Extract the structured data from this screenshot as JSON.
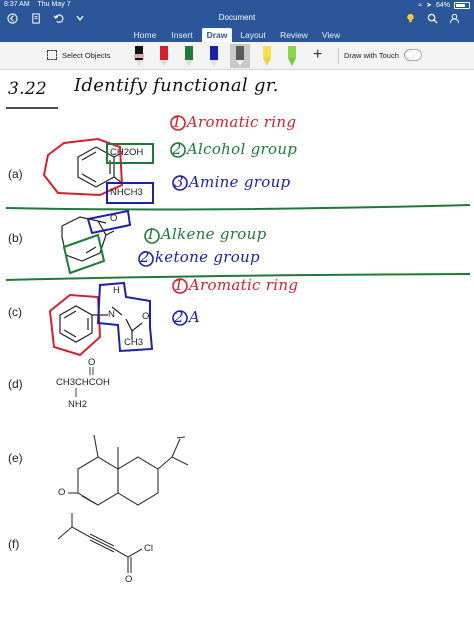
{
  "status_bar": {
    "time": "8:37 AM",
    "date": "Thu May 7",
    "battery": "64%"
  },
  "title_bar": {
    "document_title": "Document"
  },
  "ribbon": {
    "tabs": [
      "Home",
      "Insert",
      "Draw",
      "Layout",
      "Review",
      "View"
    ],
    "active_tab": "Draw"
  },
  "toolbar": {
    "select_objects_label": "Select Objects",
    "draw_with_touch_label": "Draw with Touch",
    "pens": [
      {
        "name": "pen-black",
        "color": "#111111"
      },
      {
        "name": "pen-red",
        "color": "#d41f2e"
      },
      {
        "name": "pen-green",
        "color": "#1f7a3a"
      },
      {
        "name": "pen-blue",
        "color": "#1c22a8"
      },
      {
        "name": "pen-gray",
        "color": "#7a7a7a"
      },
      {
        "name": "highlighter-yellow",
        "color": "#f4e04d"
      },
      {
        "name": "highlighter-green",
        "color": "#8fd44f"
      }
    ]
  },
  "colors": {
    "chrome_blue": "#2b579a",
    "ink_red": "#d41f2e",
    "ink_green": "#1f7a3a",
    "ink_blue": "#1c22a8"
  },
  "document": {
    "heading_number": "3.22",
    "heading_text": "Identify functional gr.",
    "problems": {
      "a": {
        "label": "(a)",
        "groups": [
          "CH2OH",
          "NHCH3"
        ],
        "notes": [
          "1 Aromatic ring",
          "2 Alcohol group",
          "3 Amine group"
        ]
      },
      "b": {
        "label": "(b)",
        "groups": [
          "O"
        ],
        "notes": [
          "1 Alkene group",
          "2 ketone group"
        ]
      },
      "c": {
        "label": "(c)",
        "groups": [
          "H",
          "N",
          "O",
          "CH3"
        ],
        "notes": [
          "1 Aromatic ring",
          "2 A"
        ]
      },
      "d": {
        "label": "(d)",
        "groups": [
          "O",
          "CH3CHCOH",
          "NH2"
        ]
      },
      "e": {
        "label": "(e)",
        "groups": [
          "O"
        ]
      },
      "f": {
        "label": "(f)",
        "groups": [
          "Cl",
          "O"
        ]
      }
    }
  }
}
